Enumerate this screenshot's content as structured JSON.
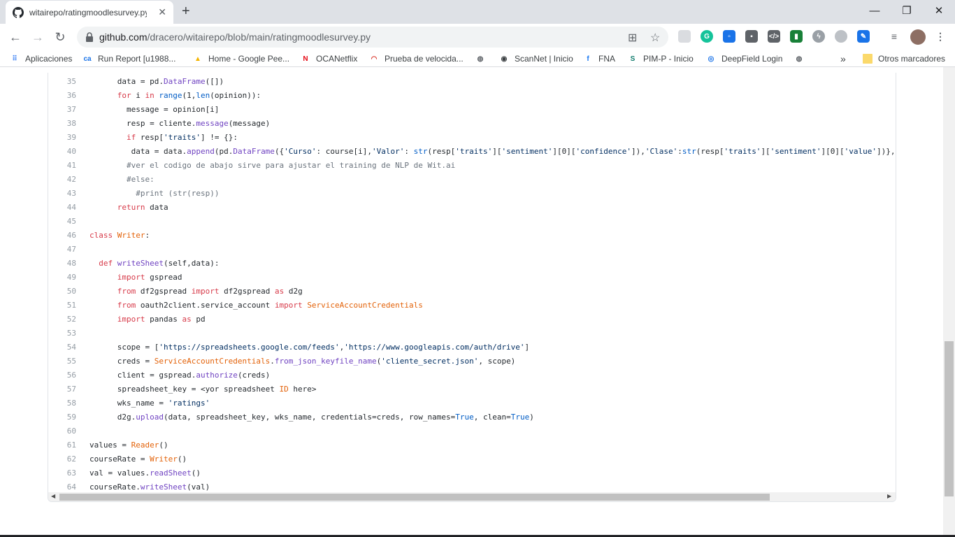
{
  "tab": {
    "title": "witairepo/ratingmoodlesurvey.py",
    "close": "✕"
  },
  "newtab": "+",
  "window": {
    "minimize": "—",
    "maximize": "❐",
    "close": "✕"
  },
  "nav": {
    "back": "←",
    "forward": "→",
    "reload": "↻"
  },
  "url": {
    "host": "github.com",
    "path": "/dracero/witairepo/blob/main/ratingmoodlesurvey.py"
  },
  "bookmarks": [
    {
      "label": "Aplicaciones",
      "icon": "apps-grid-icon",
      "glyph": "⠿",
      "color": "#4285f4"
    },
    {
      "label": "Run Report [u1988...",
      "icon": "report-icon",
      "glyph": "ca",
      "color": "#1a73e8"
    },
    {
      "label": "Home - Google Pee...",
      "icon": "google-icon",
      "glyph": "▲",
      "color": "#f4b400"
    },
    {
      "label": "OCANetflix",
      "icon": "netflix-icon",
      "glyph": "N",
      "color": "#e50914"
    },
    {
      "label": "Prueba de velocida...",
      "icon": "speedtest-icon",
      "glyph": "◠",
      "color": "#d93025"
    },
    {
      "label": "",
      "icon": "globe-icon",
      "glyph": "◍",
      "color": "#5f6368"
    },
    {
      "label": "ScanNet | Inicio",
      "icon": "scannet-icon",
      "glyph": "◉",
      "color": "#3c4043"
    },
    {
      "label": "FNA",
      "icon": "facebook-icon",
      "glyph": "f",
      "color": "#1877f2"
    },
    {
      "label": "PIM-P - Inicio",
      "icon": "sharepoint-icon",
      "glyph": "S",
      "color": "#0f7b6c"
    },
    {
      "label": "DeepField Login",
      "icon": "deepfield-icon",
      "glyph": "◎",
      "color": "#1a73e8"
    },
    {
      "label": "",
      "icon": "globe-icon",
      "glyph": "◍",
      "color": "#5f6368"
    }
  ],
  "bookmarks_more": "»",
  "other_bookmarks": "Otros marcadores",
  "code_lines": [
    {
      "n": "35",
      "html": "      data = pd.<span class=\"f\">DataFrame</span>([])"
    },
    {
      "n": "36",
      "html": "      <span class=\"k\">for</span> i <span class=\"k\">in</span> <span class=\"b\">range</span>(1,<span class=\"b\">len</span>(opinion)):"
    },
    {
      "n": "37",
      "html": "        message = opinion[i]"
    },
    {
      "n": "38",
      "html": "        resp = cliente.<span class=\"f\">message</span>(message)"
    },
    {
      "n": "39",
      "html": "        <span class=\"k\">if</span> resp[<span class=\"s\">'traits'</span>] != {}:"
    },
    {
      "n": "40",
      "html": "         data = data.<span class=\"f\">append</span>(pd.<span class=\"f\">DataFrame</span>({<span class=\"s\">'Curso'</span>: course[i],<span class=\"s\">'Valor'</span>: <span class=\"b\">str</span>(resp[<span class=\"s\">'traits'</span>][<span class=\"s\">'sentiment'</span>][0][<span class=\"s\">'confidence'</span>]),<span class=\"s\">'Clase'</span>:<span class=\"b\">str</span>(resp[<span class=\"s\">'traits'</span>][<span class=\"s\">'sentiment'</span>][0][<span class=\"s\">'value'</span>])}, in"
    },
    {
      "n": "41",
      "html": "        <span class=\"c\">#ver el codigo de abajo sirve para ajustar el training de NLP de Wit.ai</span>"
    },
    {
      "n": "42",
      "html": "        <span class=\"c\">#else:</span>"
    },
    {
      "n": "43",
      "html": "          <span class=\"c\">#print (str(resp))</span>"
    },
    {
      "n": "44",
      "html": "      <span class=\"k\">return</span> data"
    },
    {
      "n": "45",
      "html": ""
    },
    {
      "n": "46",
      "html": "<span class=\"k\">class</span> <span class=\"e\">Writer</span>:"
    },
    {
      "n": "47",
      "html": ""
    },
    {
      "n": "48",
      "html": "  <span class=\"k\">def</span> <span class=\"f\">writeSheet</span>(self,data):"
    },
    {
      "n": "49",
      "html": "      <span class=\"k\">import</span> gspread"
    },
    {
      "n": "50",
      "html": "      <span class=\"k\">from</span> df2gspread <span class=\"k\">import</span> df2gspread <span class=\"k\">as</span> d2g"
    },
    {
      "n": "51",
      "html": "      <span class=\"k\">from</span> oauth2client.service_account <span class=\"k\">import</span> <span class=\"e\">ServiceAccountCredentials</span>"
    },
    {
      "n": "52",
      "html": "      <span class=\"k\">import</span> pandas <span class=\"k\">as</span> pd"
    },
    {
      "n": "53",
      "html": ""
    },
    {
      "n": "54",
      "html": "      scope = [<span class=\"s\">'https://spreadsheets.google.com/feeds'</span>,<span class=\"s\">'https://www.googleapis.com/auth/drive'</span>]"
    },
    {
      "n": "55",
      "html": "      creds = <span class=\"e\">ServiceAccountCredentials</span>.<span class=\"f\">from_json_keyfile_name</span>(<span class=\"s\">'cliente_secret.json'</span>, scope)"
    },
    {
      "n": "56",
      "html": "      client = gspread.<span class=\"f\">authorize</span>(creds)"
    },
    {
      "n": "57",
      "html": "      spreadsheet_key = &lt;yor spreadsheet <span class=\"e\">ID</span> here&gt;"
    },
    {
      "n": "58",
      "html": "      wks_name = <span class=\"s\">'ratings'</span>"
    },
    {
      "n": "59",
      "html": "      d2g.<span class=\"f\">upload</span>(data, spreadsheet_key, wks_name, credentials=creds, row_names=<span class=\"b\">True</span>, clean=<span class=\"b\">True</span>)"
    },
    {
      "n": "60",
      "html": ""
    },
    {
      "n": "61",
      "html": "values = <span class=\"e\">Reader</span>()"
    },
    {
      "n": "62",
      "html": "courseRate = <span class=\"e\">Writer</span>()"
    },
    {
      "n": "63",
      "html": "val = values.<span class=\"f\">readSheet</span>()"
    },
    {
      "n": "64",
      "html": "courseRate.<span class=\"f\">writeSheet</span>(val)"
    }
  ]
}
